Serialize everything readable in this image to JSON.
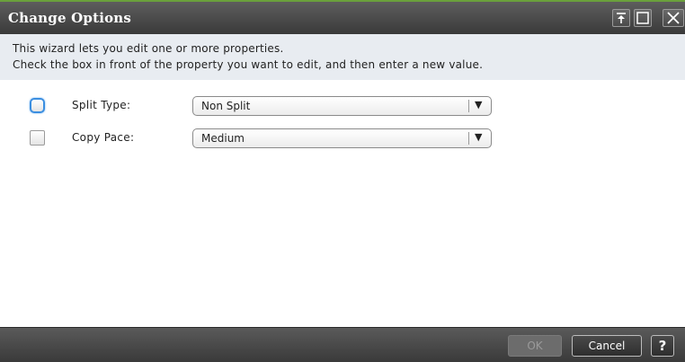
{
  "window": {
    "title": "Change Options",
    "accent_color": "#6aa13c",
    "titlebar_buttons": [
      {
        "name": "pin-icon"
      },
      {
        "name": "maximize-icon"
      },
      {
        "name": "close-icon"
      }
    ]
  },
  "intro": {
    "line1": "This wizard lets you edit one or more properties.",
    "line2": "Check the box in front of the property you want to edit, and then enter a new value."
  },
  "properties": [
    {
      "label": "Split Type:",
      "value": "Non Split",
      "checked": false,
      "focused": true
    },
    {
      "label": "Copy Pace:",
      "value": "Medium",
      "checked": false,
      "focused": false
    }
  ],
  "footer": {
    "ok_label": "OK",
    "ok_enabled": false,
    "cancel_label": "Cancel",
    "help_label": "?"
  }
}
